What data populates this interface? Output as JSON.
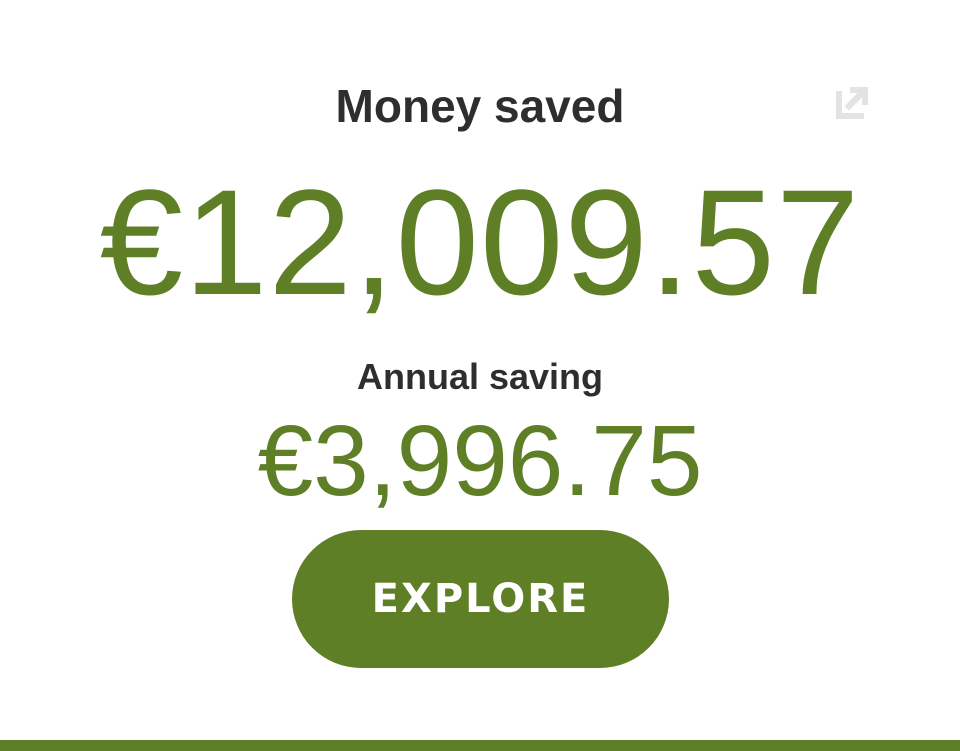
{
  "card": {
    "title": "Money saved",
    "expand_icon": "external-link-icon",
    "total_amount": "€12,009.57",
    "annual_label": "Annual saving",
    "annual_amount": "€3,996.75",
    "explore_label": "EXPLORE"
  },
  "colors": {
    "accent": "#5f7f26",
    "text": "#2e2e30",
    "icon": "#e3e3e3",
    "background": "#ffffff"
  }
}
